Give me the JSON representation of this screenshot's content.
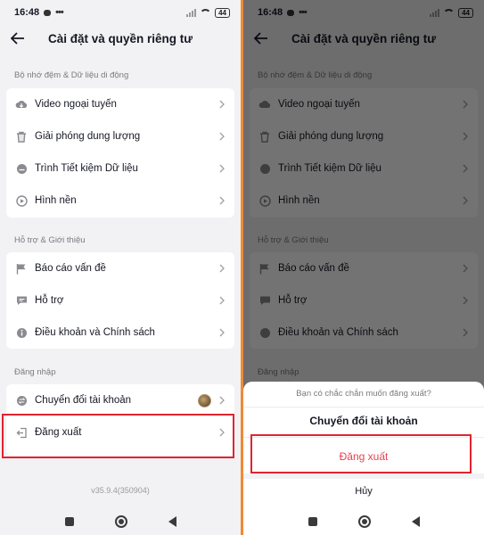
{
  "status": {
    "time": "16:48",
    "battery": "44"
  },
  "header": {
    "title": "Cài đặt và quyền riêng tư"
  },
  "sections": {
    "cache": {
      "label": "Bộ nhớ đệm & Dữ liệu di động",
      "items": [
        {
          "label": "Video ngoại tuyến",
          "icon": "cloud-download-icon"
        },
        {
          "label": "Giải phóng dung lượng",
          "icon": "trash-icon"
        },
        {
          "label": "Trình Tiết kiệm Dữ liệu",
          "icon": "data-saver-icon"
        },
        {
          "label": "Hình nền",
          "icon": "wallpaper-icon"
        }
      ]
    },
    "support": {
      "label": "Hỗ trợ & Giới thiệu",
      "items": [
        {
          "label": "Báo cáo vấn đề",
          "icon": "flag-icon"
        },
        {
          "label": "Hỗ trợ",
          "icon": "chat-icon"
        },
        {
          "label": "Điều khoản và Chính sách",
          "icon": "info-icon"
        }
      ]
    },
    "login": {
      "label": "Đăng nhập",
      "items": [
        {
          "label": "Chuyển đổi tài khoản",
          "icon": "switch-account-icon"
        },
        {
          "label": "Đăng xuất",
          "icon": "logout-icon"
        }
      ]
    }
  },
  "version": "v35.9.4(350904)",
  "dialog": {
    "question": "Bạn có chắc chắn muốn đăng xuất?",
    "switch_label": "Chuyển đổi tài khoản",
    "logout_label": "Đăng xuất",
    "cancel_label": "Hủy"
  },
  "colors": {
    "accent_red": "#e0242e",
    "logout_text": "#e8414e",
    "divider": "#f08a32"
  }
}
